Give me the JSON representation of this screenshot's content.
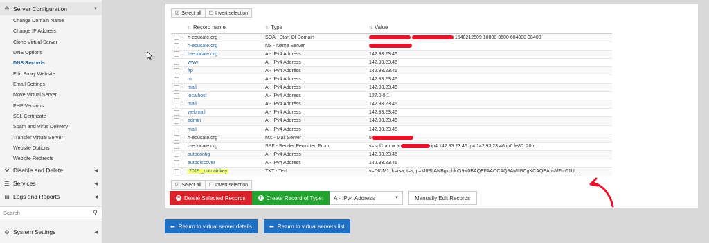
{
  "sidebar": {
    "server_config": {
      "label": "Server Configuration",
      "icon": "gears-icon"
    },
    "items": [
      {
        "label": "Change Domain Name"
      },
      {
        "label": "Change IP Address"
      },
      {
        "label": "Clone Virtual Server"
      },
      {
        "label": "DNS Options"
      },
      {
        "label": "DNS Records",
        "active": true
      },
      {
        "label": "Edit Proxy Website"
      },
      {
        "label": "Email Settings"
      },
      {
        "label": "Move Virtual Server"
      },
      {
        "label": "PHP Versions"
      },
      {
        "label": "SSL Certificate"
      },
      {
        "label": "Spam and Virus Delivery"
      },
      {
        "label": "Transfer Virtual Server"
      },
      {
        "label": "Website Options"
      },
      {
        "label": "Website Redirects"
      }
    ],
    "sections": {
      "disable_delete": "Disable and Delete",
      "services": "Services",
      "logs_reports": "Logs and Reports"
    },
    "search": {
      "placeholder": "Search"
    },
    "system_settings": "System Settings"
  },
  "selection": {
    "select_all": "Select all",
    "invert_selection": "Invert selection"
  },
  "table": {
    "columns": {
      "name": "Record name",
      "type": "Type",
      "value": "Value"
    },
    "rows": [
      {
        "name": "h-educate.org",
        "type": "SOA - Start Of Domain",
        "value": "1548212509 10800 3600 604800 38400",
        "redacted": "soa"
      },
      {
        "name": "h-educate.org",
        "type": "NS - Name Server",
        "value": "",
        "redacted": "ns"
      },
      {
        "name": "h-educate.org",
        "type": "A - IPv4 Address",
        "value": "142.93.23.46"
      },
      {
        "name": "www",
        "type": "A - IPv4 Address",
        "value": "142.93.23.46"
      },
      {
        "name": "ftp",
        "type": "A - IPv4 Address",
        "value": "142.93.23.46"
      },
      {
        "name": "m",
        "type": "A - IPv4 Address",
        "value": "142.93.23.46"
      },
      {
        "name": "mail",
        "type": "A - IPv4 Address",
        "value": "142.93.23.46"
      },
      {
        "name": "localhost",
        "type": "A - IPv4 Address",
        "value": "127.0.0.1"
      },
      {
        "name": "mail",
        "type": "A - IPv4 Address",
        "value": "142.93.23.46"
      },
      {
        "name": "webmail",
        "type": "A - IPv4 Address",
        "value": "142.93.23.46"
      },
      {
        "name": "admin",
        "type": "A - IPv4 Address",
        "value": "142.93.23.46"
      },
      {
        "name": "mail",
        "type": "A - IPv4 Address",
        "value": "142.93.23.46"
      },
      {
        "name": "h-educate.org",
        "type": "MX - Mail Server",
        "value": "5",
        "redacted": "mx"
      },
      {
        "name": "h-educate.org",
        "type": "SPF - Sender Permitted From",
        "value": "v=spf1 a mx a:",
        "value_suffix": "ip4:142.93.23.46 ip4:142.93.23.46 ip6:fe80::20b ...",
        "redacted": "spf"
      },
      {
        "name": "autoconfig",
        "type": "A - IPv4 Address",
        "value": "142.93.23.46"
      },
      {
        "name": "autodiscover",
        "type": "A - IPv4 Address",
        "value": "142.93.23.46"
      },
      {
        "name": "2019._domainkey",
        "type": "TXT - Text",
        "value": "v=DKIM1; k=rsa; t=s; p=MIIBIjANBgkqhkiG9w0BAQEFAAOCAQ8AMIIBCgKCAQEAosMFm61U ...",
        "highlight": true
      }
    ]
  },
  "actions": {
    "delete_selected": "Delete Selected Records",
    "create_record": "Create Record of Type:",
    "record_type_selected": "A - IPv4 Address",
    "manual_edit": "Manually Edit Records"
  },
  "nav": {
    "back_details": "Return to virtual server details",
    "back_list": "Return to virtual servers list"
  },
  "colors": {
    "link": "#2a6496",
    "delete_button": "#d9222a",
    "create_button": "#23a330",
    "nav_button": "#1f6fc4",
    "highlight": "#ffff66",
    "redaction": "#e8132a"
  }
}
